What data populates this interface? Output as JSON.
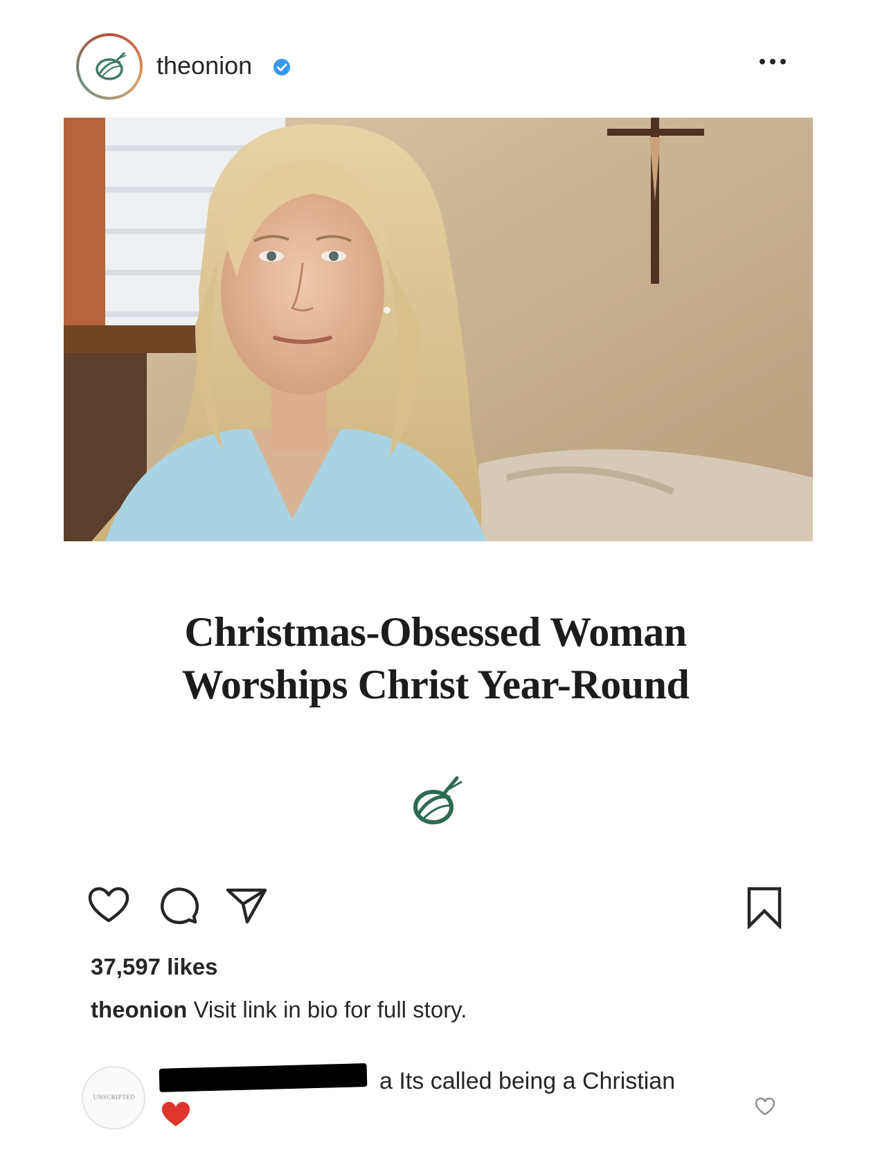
{
  "post": {
    "username": "theonion",
    "verified": true,
    "more_icon": "ellipsis-icon"
  },
  "article": {
    "headline_line1": "Christmas-Obsessed Woman",
    "headline_line2": "Worships Christ Year-Round",
    "brand_color": "#2e6b52"
  },
  "actions": {
    "icons": [
      "heart-icon",
      "comment-icon",
      "share-icon",
      "bookmark-icon"
    ]
  },
  "likes": "37,597 likes",
  "caption": {
    "username": "theonion",
    "text": "Visit link in bio for full story."
  },
  "comment": {
    "avatar_text": "UNSCRIPTED",
    "text": "a Its called being a Christian",
    "redacted": true
  },
  "colors": {
    "verified_blue": "#3897f0",
    "heart_red": "#e0352b",
    "onion_green": "#2e6b52"
  }
}
